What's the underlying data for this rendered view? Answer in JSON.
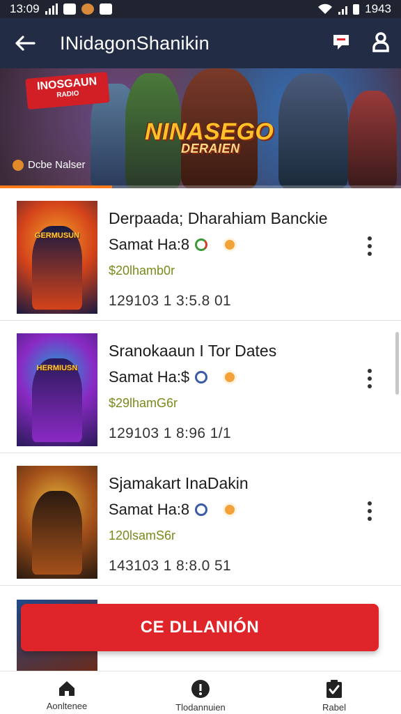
{
  "status_bar": {
    "time": "13:09",
    "battery": "1943"
  },
  "app_bar": {
    "title": "INidagonShanikin"
  },
  "banner": {
    "badge_title": "INOSGAUN",
    "badge_sub": "RADIO",
    "logo_title": "NINASEGO",
    "logo_sub": "DERAIEN",
    "creator": "Dcbe Nalser",
    "progress": 0.28
  },
  "items": [
    {
      "name": "Derpaada; Dharahiam Banckie",
      "meta": "Samat Ha:8",
      "price": "$20lhamb0r",
      "stats": "129103  1  3:5.8 01",
      "thumb_title": "GERMUSUN",
      "colors": [
        "#1a1a40",
        "#d4431a",
        "#f4a12a"
      ]
    },
    {
      "name": "Sranokaaun I Tor Dates",
      "meta": "Samat Ha:$",
      "price": "$29lhamG6r",
      "stats": "129103  1  8:96 1/1",
      "thumb_title": "HERMIUSN",
      "colors": [
        "#2a1a5a",
        "#8a2ac4",
        "#1aa4d4"
      ]
    },
    {
      "name": "Sjamakart InaDakin",
      "meta": "Samat Ha:8",
      "price": "120lsamS6r",
      "stats": "143103  1  8:8.0 51",
      "thumb_title": "",
      "colors": [
        "#2a1a10",
        "#a4501a",
        "#e4b43a"
      ]
    }
  ],
  "cta": {
    "label": "CE DLLANIÓN"
  },
  "bottom_nav": [
    {
      "label": "Aonltenee",
      "icon": "home-icon"
    },
    {
      "label": "Tlodannuien",
      "icon": "info-icon"
    },
    {
      "label": "Rabel",
      "icon": "clipboard-check-icon"
    }
  ],
  "colors": {
    "app_bar": "#222c44",
    "cta": "#e0252a",
    "price": "#7a8a1a"
  }
}
